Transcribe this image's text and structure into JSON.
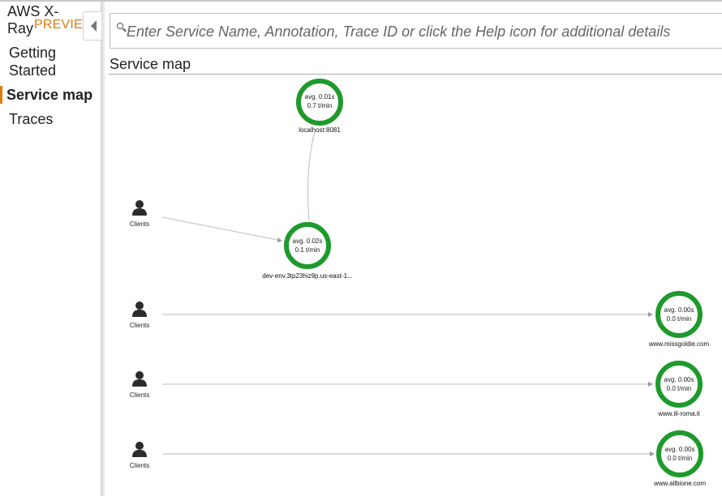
{
  "sidebar": {
    "brand_line1": "AWS X-",
    "brand_line2": "Ray",
    "preview_badge": "PREVIEW",
    "items": [
      {
        "label": "Getting Started",
        "active": false
      },
      {
        "label": "Service map",
        "active": true
      },
      {
        "label": "Traces",
        "active": false
      }
    ]
  },
  "search": {
    "placeholder": "Enter Service Name, Annotation, Trace ID or click the Help icon for additional details",
    "value": ""
  },
  "main": {
    "title": "Service map"
  },
  "service_map": {
    "status_color": "#1e9a2c",
    "clients": [
      {
        "label": "Clients"
      },
      {
        "label": "Clients"
      },
      {
        "label": "Clients"
      },
      {
        "label": "Clients"
      }
    ],
    "services": [
      {
        "name": "localhost:8081",
        "avg": "avg. 0.01s",
        "rate": "0.7 t/min"
      },
      {
        "name": "dev-env.3tp23hiz9p.us-east-1...",
        "avg": "avg. 0.02s",
        "rate": "0.1 t/min"
      },
      {
        "name": "www.missgoldie.com",
        "avg": "avg. 0.00s",
        "rate": "0.0 t/min"
      },
      {
        "name": "www.ili-roma.it",
        "avg": "avg. 0.00s",
        "rate": "0.0 t/min"
      },
      {
        "name": "www.allbione.com",
        "avg": "avg. 0.00s",
        "rate": "0.0 t/min"
      }
    ]
  }
}
